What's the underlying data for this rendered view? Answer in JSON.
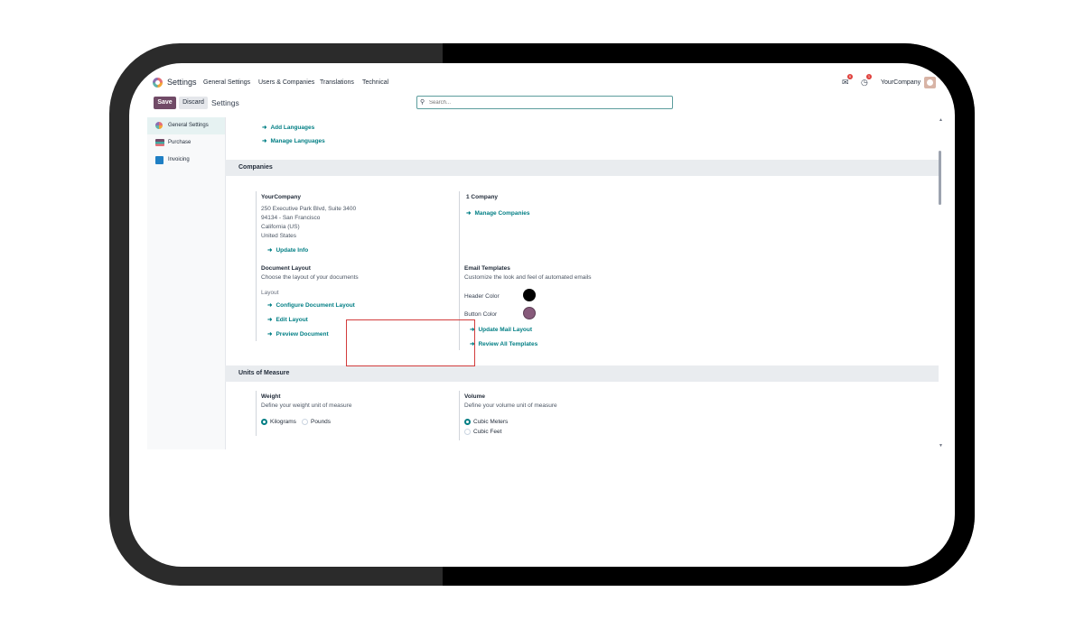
{
  "navbar": {
    "app_title": "Settings",
    "menu": [
      "General Settings",
      "Users & Companies",
      "Translations",
      "Technical"
    ],
    "chat_badge": "6",
    "activity_badge": "1",
    "company": "YourCompany"
  },
  "control": {
    "save_label": "Save",
    "discard_label": "Discard",
    "breadcrumb": "Settings",
    "search_placeholder": "Search..."
  },
  "sidebar": {
    "items": [
      {
        "label": "General Settings",
        "icon": "settings-icon",
        "color": "#e46f78"
      },
      {
        "label": "Purchase",
        "icon": "purchase-icon",
        "color": "#714b67"
      },
      {
        "label": "Invoicing",
        "icon": "invoicing-icon",
        "color": "#1f7fc4"
      }
    ]
  },
  "languages": {
    "add_languages": "Add Languages",
    "manage_languages": "Manage Languages"
  },
  "companies": {
    "title": "Companies",
    "company_name": "YourCompany",
    "address": [
      "250 Executive Park Blvd, Suite 3400",
      "94134 - San Francisco",
      "California (US)",
      "United States"
    ],
    "update_info": "Update Info",
    "count_label": "1 Company",
    "manage_companies": "Manage Companies"
  },
  "document_layout": {
    "title": "Document Layout",
    "description": "Choose the layout of your documents",
    "layout_label": "Layout",
    "configure": "Configure Document Layout",
    "edit": "Edit Layout",
    "preview": "Preview Document"
  },
  "email_templates": {
    "title": "Email Templates",
    "description": "Customize the look and feel of automated emails",
    "header_color_label": "Header Color",
    "header_color": "#000000",
    "button_color_label": "Button Color",
    "button_color": "#875a7b",
    "update_mail_layout": "Update Mail Layout",
    "review_templates": "Review All Templates"
  },
  "units": {
    "title": "Units of Measure",
    "weight_title": "Weight",
    "weight_desc": "Define your weight unit of measure",
    "weight_options": [
      "Kilograms",
      "Pounds"
    ],
    "weight_selected": "Kilograms",
    "volume_title": "Volume",
    "volume_desc": "Define your volume unit of measure",
    "volume_options": [
      "Cubic Meters",
      "Cubic Feet"
    ],
    "volume_selected": "Cubic Meters"
  },
  "accent_color": "#017e84",
  "brand_color": "#714b67"
}
